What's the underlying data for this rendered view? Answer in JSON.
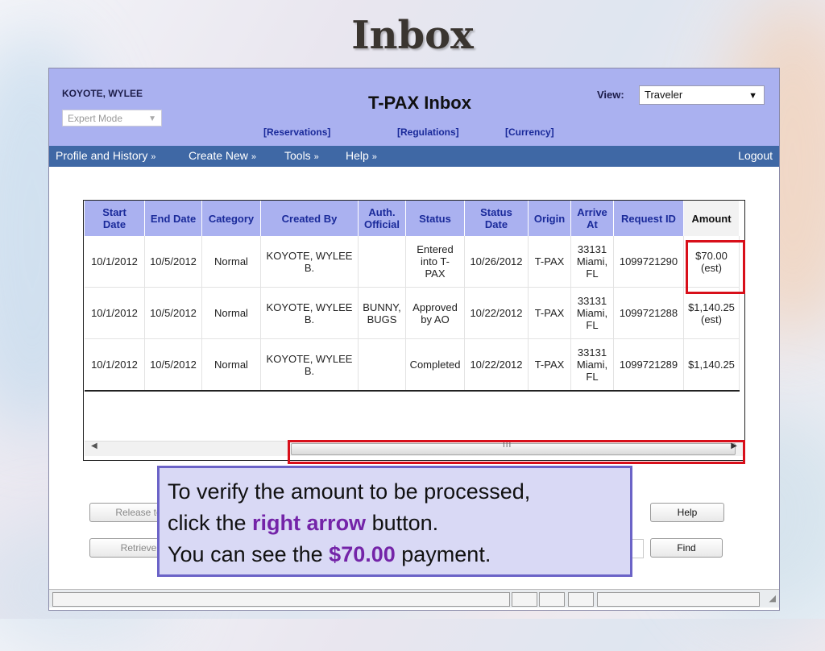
{
  "slide": {
    "title": "Inbox"
  },
  "header": {
    "user_name": "KOYOTE, WYLEE",
    "mode": "Expert Mode",
    "app_title": "T-PAX Inbox",
    "view_label": "View:",
    "view_value": "Traveler",
    "links": [
      "[Reservations]",
      "[Regulations]",
      "[Currency]"
    ]
  },
  "nav": {
    "items": [
      "Profile and History",
      "Create New",
      "Tools",
      "Help"
    ],
    "logout": "Logout"
  },
  "grid": {
    "columns": [
      [
        "Start",
        "Date"
      ],
      [
        "End Date"
      ],
      [
        "Category"
      ],
      [
        "Created By"
      ],
      [
        "Auth.",
        "Official"
      ],
      [
        "Status"
      ],
      [
        "Status",
        "Date"
      ],
      [
        "Origin"
      ],
      [
        "Arrive",
        "At"
      ],
      [
        "Request ID"
      ],
      [
        "Amount"
      ]
    ],
    "rows": [
      {
        "start": "10/1/2012",
        "end": "10/5/2012",
        "category": "Normal",
        "created_by": [
          "KOYOTE, WYLEE",
          "B."
        ],
        "auth": [],
        "status": [
          "Entered",
          "into T-",
          "PAX"
        ],
        "status_date": "10/26/2012",
        "origin": "T-PAX",
        "arrive": [
          "33131",
          "Miami,",
          "FL"
        ],
        "request_id": "1099721290",
        "amount": [
          "$70.00",
          "(est)"
        ]
      },
      {
        "start": "10/1/2012",
        "end": "10/5/2012",
        "category": "Normal",
        "created_by": [
          "KOYOTE, WYLEE",
          "B."
        ],
        "auth": [
          "BUNNY,",
          "BUGS"
        ],
        "status": [
          "Approved",
          "by AO"
        ],
        "status_date": "10/22/2012",
        "origin": "T-PAX",
        "arrive": [
          "33131",
          "Miami,",
          "FL"
        ],
        "request_id": "1099721288",
        "amount": [
          "$1,140.25",
          "(est)"
        ]
      },
      {
        "start": "10/1/2012",
        "end": "10/5/2012",
        "category": "Normal",
        "created_by": [
          "KOYOTE, WYLEE",
          "B."
        ],
        "auth": [],
        "status": [
          "Completed"
        ],
        "status_date": "10/22/2012",
        "origin": "T-PAX",
        "arrive": [
          "33131",
          "Miami,",
          "FL"
        ],
        "request_id": "1099721289",
        "amount": [
          "$1,140.25"
        ]
      }
    ]
  },
  "scrollbar": {
    "grip": "III"
  },
  "buttons": {
    "release": "Release to",
    "retrieve": "Retrieve",
    "help": "Help",
    "find": "Find"
  },
  "callout": {
    "line1": "To verify the amount to be processed,",
    "line2_pre": "click the ",
    "line2_hl": "right arrow",
    "line2_post": " button.",
    "line3_pre": "You can see the ",
    "line3_hl": "$70.00",
    "line3_post": " payment."
  },
  "colors": {
    "highlight_red": "#d80f1a",
    "callout_border": "#6b63c7",
    "callout_text_hl": "#7424a8",
    "header_bg": "#aab1f0",
    "nav_bg": "#3f68a5"
  }
}
